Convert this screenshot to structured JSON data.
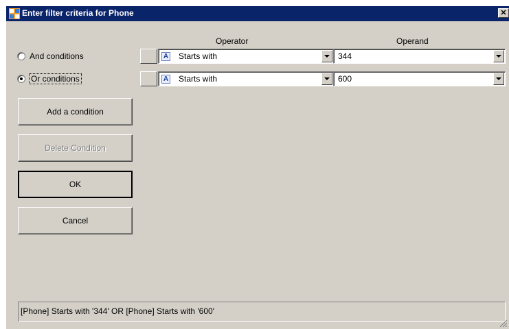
{
  "window": {
    "title": "Enter filter criteria for Phone",
    "close": "✕"
  },
  "grid": {
    "operator_header": "Operator",
    "operand_header": "Operand",
    "rows": [
      {
        "operator": "Starts with",
        "operand": "344"
      },
      {
        "operator": "Starts with",
        "operand": "600"
      }
    ]
  },
  "logic": {
    "and_label": "And conditions",
    "or_label": "Or conditions",
    "selected": "or"
  },
  "buttons": {
    "add_condition": "Add a condition",
    "delete_condition": "Delete Condition",
    "ok": "OK",
    "cancel": "Cancel"
  },
  "status": {
    "expression": "[Phone] Starts with '344' OR [Phone] Starts with '600'"
  },
  "icons": {
    "window": "window-app-icon",
    "operator_type": "text-type-icon"
  }
}
